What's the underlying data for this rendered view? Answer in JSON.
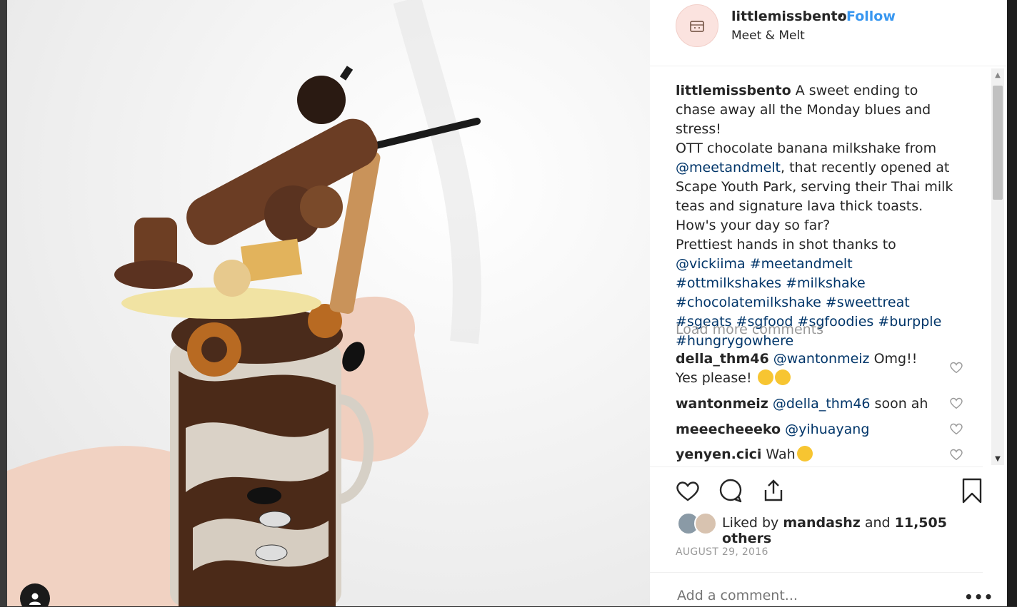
{
  "post": {
    "username": "littlemissbento",
    "dot": "•",
    "follow_label": "Follow",
    "location": "Meet & Melt",
    "avatar_text": "little miss bento"
  },
  "caption": {
    "username": "littlemissbento",
    "part1": " A sweet ending to chase away all the Monday blues and stress!\nOTT chocolate banana milkshake from ",
    "mention1": "@meetandmelt",
    "part2": ", that recently opened at Scape Youth Park, serving their Thai milk teas and signature lava thick toasts.\nHow's your day so far?\nPrettiest hands in shot thanks to ",
    "mention2": "@vickiima",
    "hashtags": [
      "#meetandmelt",
      "#ottmilkshakes",
      "#milkshake",
      "#chocolatemilkshake",
      "#sweettreat",
      "#sgeats",
      "#sgfood",
      "#sgfoodies",
      "#burpple",
      "#hungrygowhere"
    ]
  },
  "load_more_label": "Load more comments",
  "comments": [
    {
      "user": "della_thm46",
      "mention": "@wantonmeiz",
      "text": " Omg!! Yes please! ",
      "emoji": "heart-eyes-emoji x2"
    },
    {
      "user": "wantonmeiz",
      "mention": "@della_thm46",
      "text": " soon ah",
      "emoji": ""
    },
    {
      "user": "meeecheeeko",
      "mention": "@yihuayang",
      "text": "",
      "emoji": ""
    },
    {
      "user": "yenyen.cici",
      "mention": "",
      "text": "Wah",
      "emoji": "yum-emoji"
    }
  ],
  "likes": {
    "prefix": "Liked by ",
    "user": "mandashz",
    "mid": " and ",
    "count": "11,505 others"
  },
  "date": "AUGUST 29, 2016",
  "add_comment_placeholder": "Add a comment...",
  "more_label": "•••",
  "colors": {
    "link": "#003569",
    "follow": "#3897f0",
    "muted": "#999999"
  }
}
